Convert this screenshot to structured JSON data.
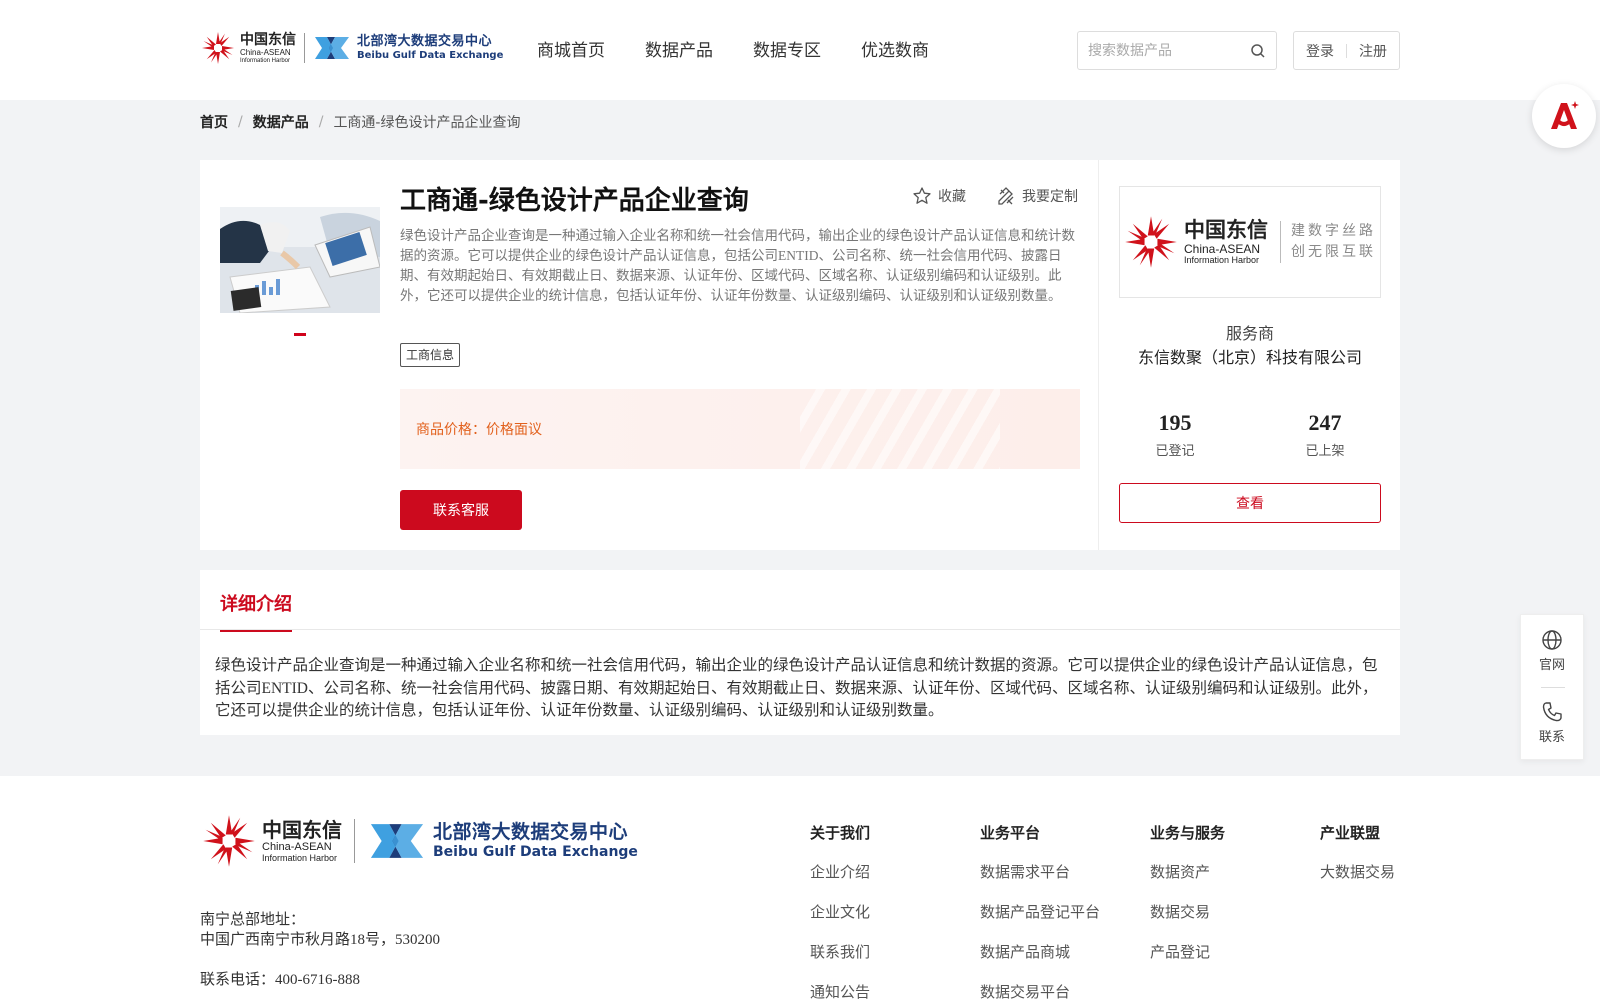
{
  "header": {
    "logo_cn": "中国东信",
    "logo_en1": "China-ASEAN",
    "logo_en2": "Information Harbor",
    "logo_bb_zh": "北部湾大数据交易中心",
    "logo_bb_en": "Beibu Gulf Data Exchange",
    "nav": [
      "商城首页",
      "数据产品",
      "数据专区",
      "优选数商"
    ],
    "search_placeholder": "搜索数据产品",
    "login": "登录",
    "register": "注册"
  },
  "breadcrumb": {
    "home": "首页",
    "section": "数据产品",
    "current": "工商通-绿色设计产品企业查询"
  },
  "product": {
    "title": "工商通-绿色设计产品企业查询",
    "favorite": "收藏",
    "customize": "我要定制",
    "description": "绿色设计产品企业查询是一种通过输入企业名称和统一社会信用代码，输出企业的绿色设计产品认证信息和统计数据的资源。它可以提供企业的绿色设计产品认证信息，包括公司ENTID、公司名称、统一社会信用代码、披露日期、有效期起始日、有效期截止日、数据来源、认证年份、区域代码、区域名称、认证级别编码和认证级别。此外，它还可以提供企业的统计信息，包括认证年份、认证年份数量、认证级别编码、认证级别和认证级别数量。",
    "tag": "工商信息",
    "price_label": "商品价格：",
    "price_value": "价格面议",
    "contact": "联系客服"
  },
  "vendor": {
    "slogan_line1": "建数字丝路",
    "slogan_line2": "创无限互联",
    "label": "服务商",
    "name": "东信数聚（北京）科技有限公司",
    "registered_count": "195",
    "registered_label": "已登记",
    "listed_count": "247",
    "listed_label": "已上架",
    "view": "查看"
  },
  "detail": {
    "tab": "详细介绍",
    "text": "绿色设计产品企业查询是一种通过输入企业名称和统一社会信用代码，输出企业的绿色设计产品认证信息和统计数据的资源。它可以提供企业的绿色设计产品认证信息，包括公司ENTID、公司名称、统一社会信用代码、披露日期、有效期起始日、有效期截止日、数据来源、认证年份、区域代码、区域名称、认证级别编码和认证级别。此外，它还可以提供企业的统计信息，包括认证年份、认证年份数量、认证级别编码、认证级别和认证级别数量。"
  },
  "side": {
    "website": "官网",
    "contact": "联系"
  },
  "footer": {
    "address_label": "南宁总部地址：",
    "address": "中国广西南宁市秋月路18号，530200",
    "phone": "联系电话：400-6716-888",
    "columns": [
      {
        "heading": "关于我们",
        "items": [
          "企业介绍",
          "企业文化",
          "联系我们",
          "通知公告"
        ]
      },
      {
        "heading": "业务平台",
        "items": [
          "数据需求平台",
          "数据产品登记平台",
          "数据产品商城",
          "数据交易平台"
        ]
      },
      {
        "heading": "业务与服务",
        "items": [
          "数据资产",
          "数据交易",
          "产品登记"
        ]
      },
      {
        "heading": "产业联盟",
        "items": [
          "大数据交易"
        ]
      }
    ]
  },
  "colors": {
    "brand_red": "#cc0a1e",
    "price_orange": "#e2611d",
    "brand_blue": "#1d3d7a",
    "page_gray": "#f2f3f5"
  }
}
